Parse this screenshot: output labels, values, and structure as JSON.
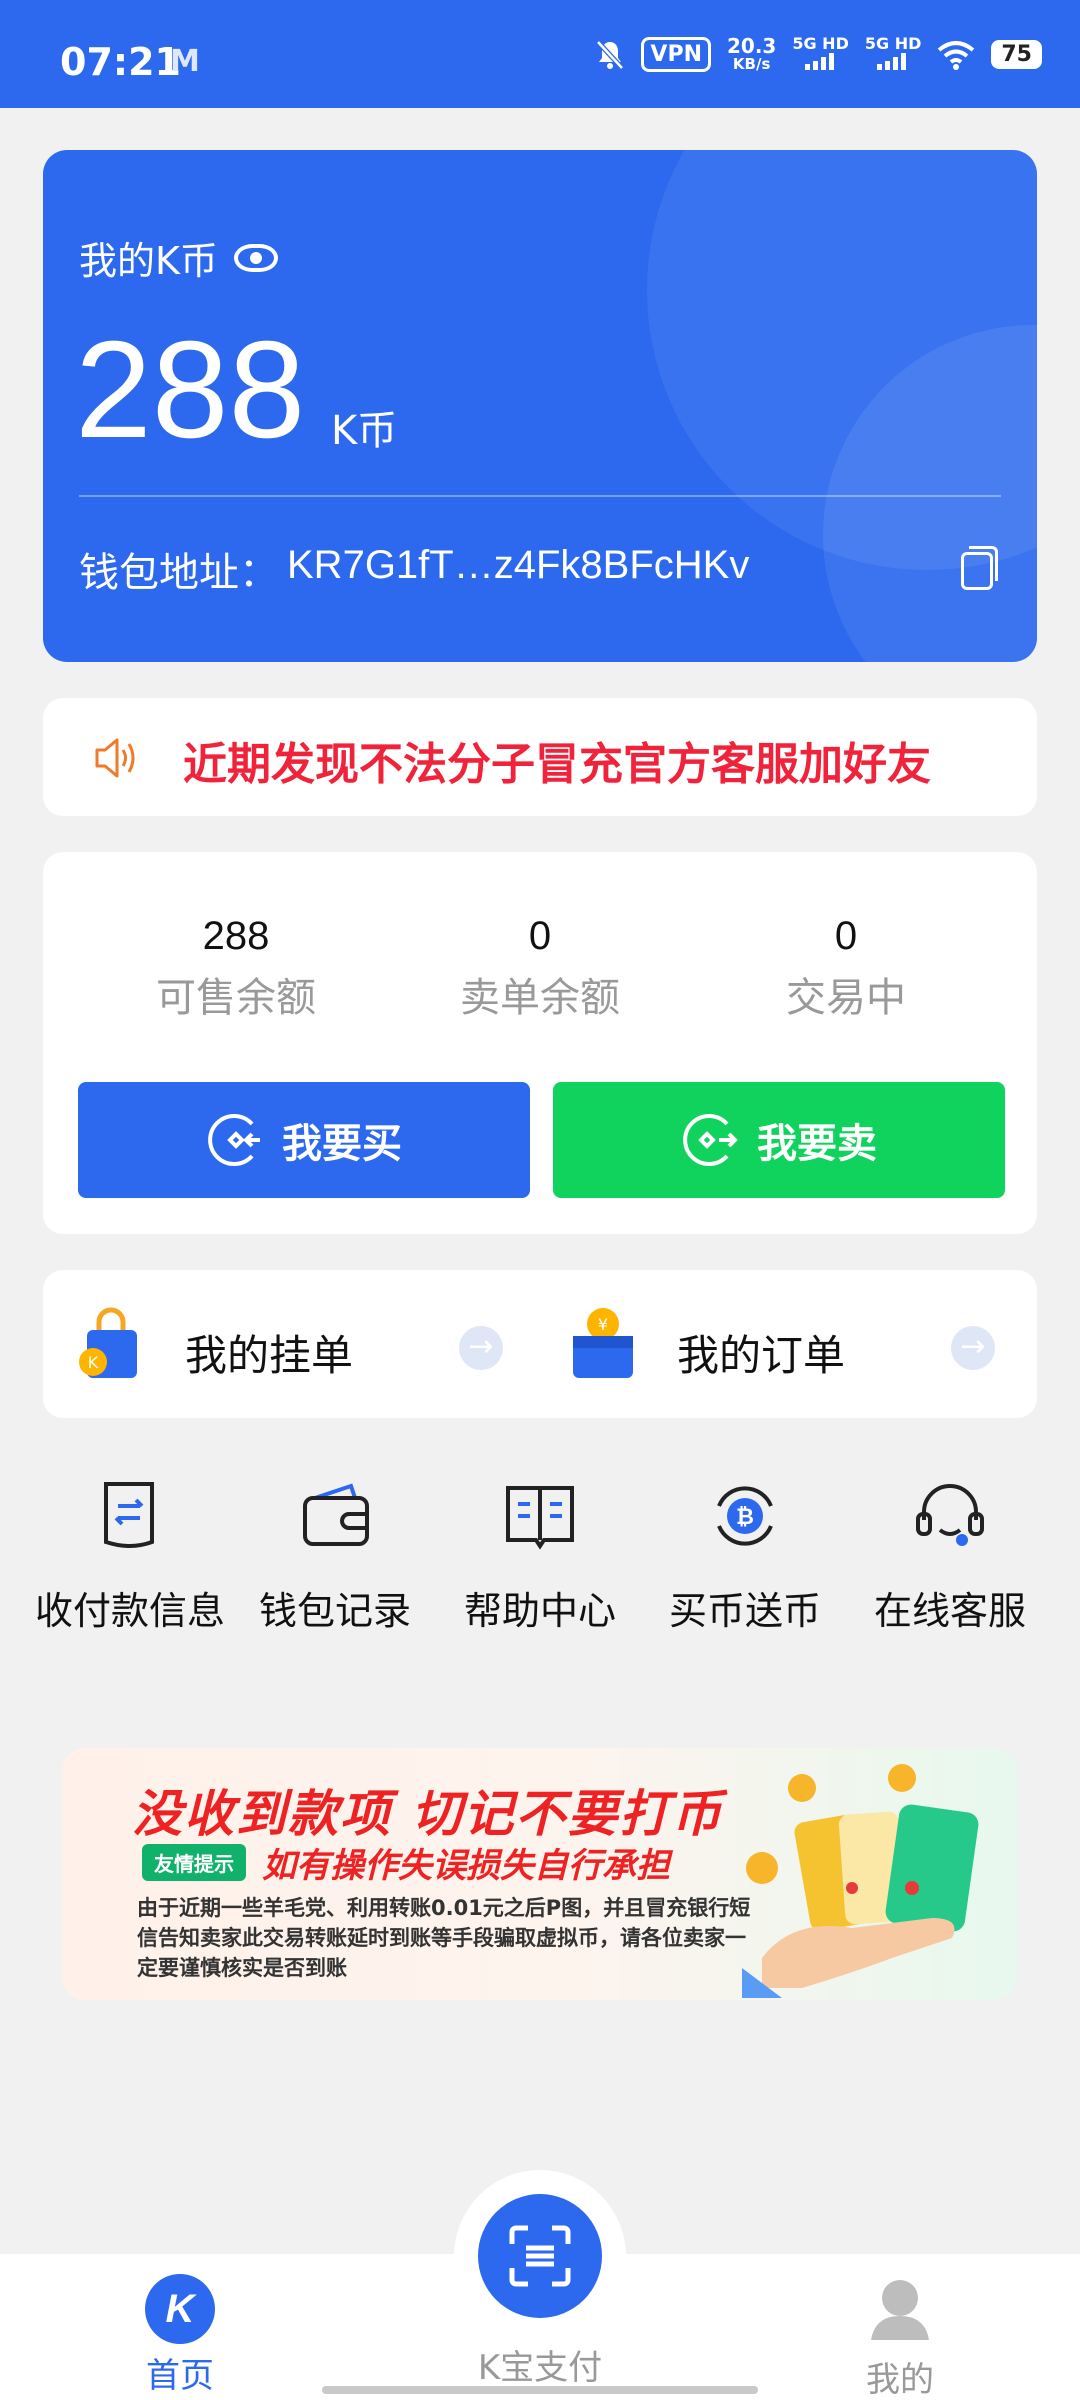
{
  "status_bar": {
    "time": "07:21",
    "mail_glyph": "M",
    "vpn": "VPN",
    "speed_value": "20.3",
    "speed_unit": "KB/s",
    "sim1": "5G HD",
    "sim2": "5G HD",
    "battery": "75"
  },
  "wallet": {
    "title": "我的K币",
    "amount": "288",
    "unit": "K币",
    "address_label": "钱包地址：",
    "address": "KR7G1fT…z4Fk8BFcHKv"
  },
  "notice": {
    "text": "近期发现不法分子冒充官方客服加好友"
  },
  "balance": {
    "stats": [
      {
        "value": "288",
        "label": "可售余额"
      },
      {
        "value": "0",
        "label": "卖单余额"
      },
      {
        "value": "0",
        "label": "交易中"
      }
    ],
    "buy_label": "我要买",
    "sell_label": "我要卖"
  },
  "orders": {
    "listings_label": "我的挂单",
    "orders_label": "我的订单"
  },
  "quick_links": [
    {
      "label": "收付款信息",
      "icon": "payment-info-icon"
    },
    {
      "label": "钱包记录",
      "icon": "wallet-icon"
    },
    {
      "label": "帮助中心",
      "icon": "book-icon"
    },
    {
      "label": "买币送币",
      "icon": "bitcoin-icon"
    },
    {
      "label": "在线客服",
      "icon": "headset-icon"
    }
  ],
  "banner": {
    "headline": "没收到款项 切记不要打币",
    "tag": "友情提示",
    "subheadline": "如有操作失误损失自行承担",
    "body": "由于近期一些羊毛党、利用转账0.01元之后P图，并且冒充银行短信告知卖家此交易转账延时到账等手段骗取虚拟币，请各位卖家一定要谨慎核实是否到账"
  },
  "nav": {
    "home": "首页",
    "pay": "K宝支付",
    "me": "我的",
    "home_glyph": "K"
  },
  "colors": {
    "primary": "#2c69ee",
    "sell": "#10d35e",
    "alert": "#f0233b"
  }
}
